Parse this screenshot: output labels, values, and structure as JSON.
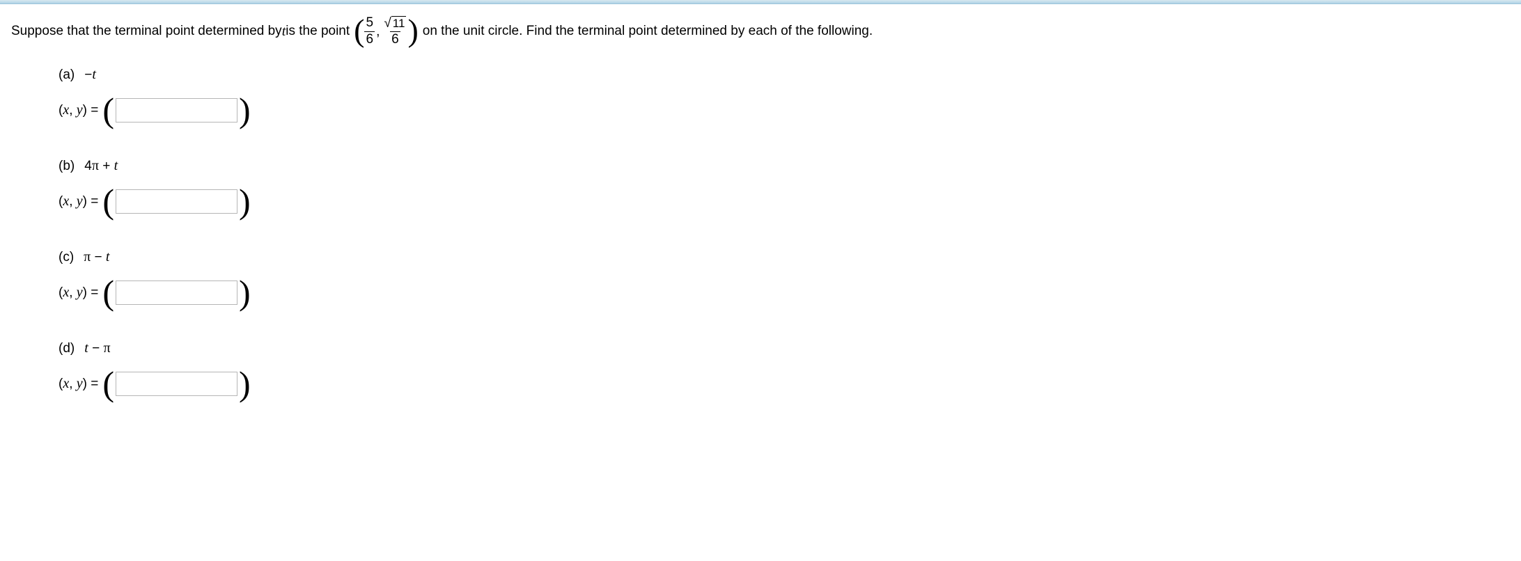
{
  "question": {
    "pre_text": "Suppose that the terminal point determined by ",
    "var": "t",
    "mid_text": " is the point ",
    "point": {
      "x_num": "5",
      "x_den": "6",
      "y_num_radicand": "11",
      "y_den": "6"
    },
    "post_text": " on the unit circle. Find the terminal point determined by each of the following."
  },
  "parts": [
    {
      "tag": "(a)",
      "expr_html": "−<span class=\"it\">t</span>",
      "xy_label": "(x, y) = ",
      "value": ""
    },
    {
      "tag": "(b)",
      "expr_html": "4<span class=\"pi\">π</span> + <span class=\"it\">t</span>",
      "xy_label": "(x, y) = ",
      "value": ""
    },
    {
      "tag": "(c)",
      "expr_html": "<span class=\"pi\">π</span> − <span class=\"it\">t</span>",
      "xy_label": "(x, y) = ",
      "value": ""
    },
    {
      "tag": "(d)",
      "expr_html": "<span class=\"it\">t</span> − <span class=\"pi\">π</span>",
      "xy_label": "(x, y) = ",
      "value": ""
    }
  ]
}
